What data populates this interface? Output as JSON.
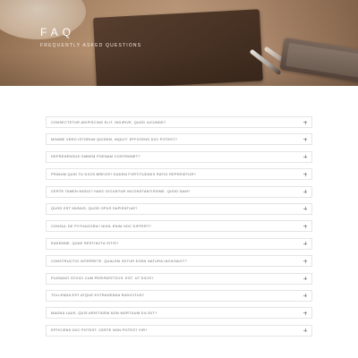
{
  "hero": {
    "title": "FAQ",
    "subtitle": "FREQUENTLY ASKED QUESTIONS"
  },
  "faq": {
    "items": [
      {
        "question": "CONSECTETUR ADIPISCING ELIT, INDIRIVE, QUOD IUCUNDE?"
      },
      {
        "question": "MINIME VERO ISTORUM QUIDEM, INQUIT. EFFICIENS DICI POTEST?"
      },
      {
        "question": "DEPREHENSUS OMNEM POENAM CONTEMNET?"
      },
      {
        "question": "PRIMUM QUID TU DICIS BREVIS? EADEM FORTITUDINIS RATIO REPERIETUR?"
      },
      {
        "question": "CERTE TAMEN MODO? HAEC DICUNTUR INCONSTANTISSIME. QUOD DAM?"
      },
      {
        "question": "QUOD EST MUNUS, QUOD OPUS SAPIENTIAE?"
      },
      {
        "question": "CONSUL DE PYTHAGORA? NIHIL ENIM HOC DIFFERT?"
      },
      {
        "question": "EADEMNE, QUAE RESTINCTA SITIS?"
      },
      {
        "question": "CONSTRUCTIO INTERRETE. QUALEM IGITUR EGEN NATURA INCHOAVIT?"
      },
      {
        "question": "PUGNANT STOICI CUM PERIPATETICIS. EST, UT DICIS?"
      },
      {
        "question": "TOLLENDA EST ATQUE EXTRAHENDA RADICITUS?"
      },
      {
        "question": "MAGNA LAUS. QUIS ARISTIDEM NON MORTUUM DILIGIT?"
      },
      {
        "question": "EFFICIENS DICI POTEST. CERTE NON POTEST VIR?"
      }
    ]
  },
  "colors": {
    "hero_overlay": "#b69173",
    "item_border": "#e4e4e4",
    "question_text": "#6a6a6a",
    "plus_icon": "#9a9a9a"
  },
  "icons": {
    "expand": "plus-icon"
  }
}
